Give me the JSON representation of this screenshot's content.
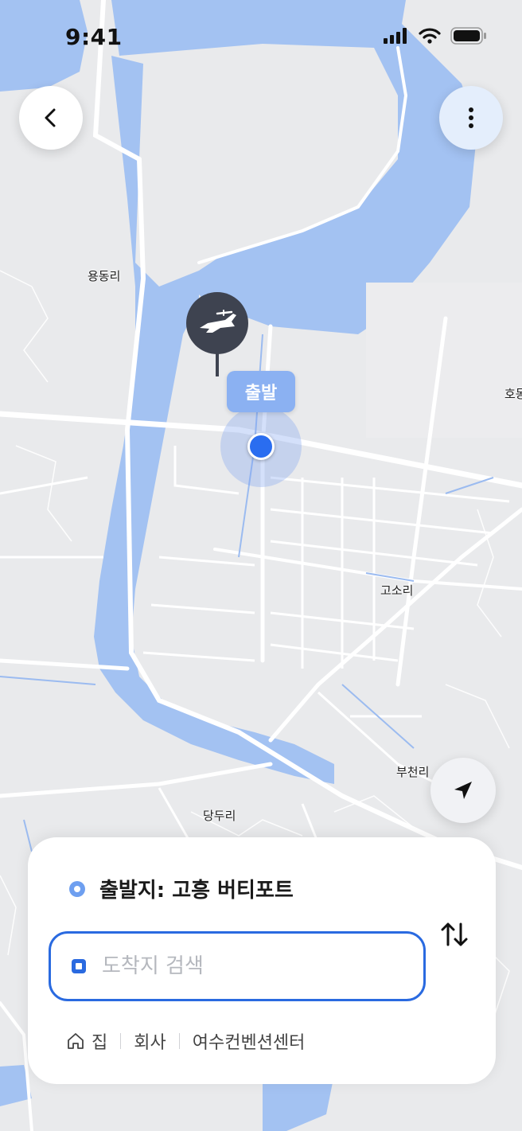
{
  "status_bar": {
    "time": "9:41"
  },
  "map": {
    "labels": {
      "yongdong": "용동리",
      "hodong": "호동",
      "goso": "고소리",
      "bucheon": "부천리",
      "dangdu": "당두리"
    },
    "origin_tag": "출발"
  },
  "panel": {
    "origin_text": "출발지: 고흥 버티포트",
    "destination_placeholder": "도착지 검색",
    "destination_value": "",
    "shortcuts": [
      "집",
      "회사",
      "여수컨벤션센터"
    ]
  },
  "colors": {
    "water": "#a3c2f2",
    "land": "#e9eaec",
    "road": "#ffffff",
    "accent": "#2a6ae0",
    "pin": "#3e4350"
  },
  "icons": {
    "back": "chevron-left-icon",
    "menu": "more-vertical-icon",
    "locate": "navigation-arrow-icon",
    "swap": "swap-vertical-icon",
    "home": "home-icon",
    "airport": "plane-icon"
  }
}
